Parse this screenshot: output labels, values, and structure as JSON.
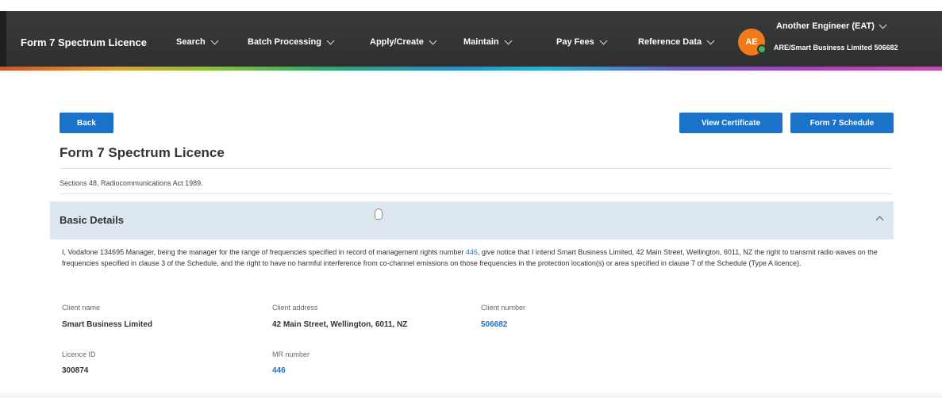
{
  "nav": {
    "brand": "Form 7 Spectrum Licence",
    "items": [
      {
        "label": "Search"
      },
      {
        "label": "Batch Processing"
      },
      {
        "label": "Apply/Create"
      },
      {
        "label": "Maintain"
      },
      {
        "label": "Pay Fees"
      },
      {
        "label": "Reference Data"
      }
    ],
    "user": {
      "initials": "AE",
      "name": "Another Engineer (EAT)",
      "org": "ARE/Smart Business Limited 506682"
    }
  },
  "toolbar": {
    "back_label": "Back",
    "view_certificate_label": "View Certificate",
    "schedule_label": "Form 7 Schedule"
  },
  "page": {
    "title": "Form 7 Spectrum Licence",
    "subtitle": "Sections 48, Radiocommunications Act 1989."
  },
  "basic_details": {
    "title": "Basic Details",
    "notice_part1": "I, Vodafone 134695 Manager, being the manager for the range of frequencies specified in record of management rights number ",
    "notice_link": "446",
    "notice_part2": ", give notice that I intend Smart Business Limited, 42 Main Street, Wellington, 6011, NZ the right to transmit radio waves on the frequencies specified in clause 3 of the Schedule, and the right to have no harmful interference from co-channel emissions on those frequencies in the protection location(s) or area specified in clause 7 of the Schedule (Type A licence).",
    "fields": {
      "client_name_label": "Client name",
      "client_name": "Smart Business Limited",
      "client_address_label": "Client address",
      "client_address": "42 Main Street, Wellington, 6011, NZ",
      "client_number_label": "Client number",
      "client_number": "506682",
      "licence_id_label": "Licence ID",
      "licence_id": "300874",
      "mr_number_label": "MR number",
      "mr_number": "446"
    }
  },
  "colors": {
    "navbar": "#2f2f2f",
    "primary_button": "#1a73c8",
    "panel_header": "#dde7f1",
    "avatar": "#f07a1a",
    "link": "#1a73c8"
  }
}
